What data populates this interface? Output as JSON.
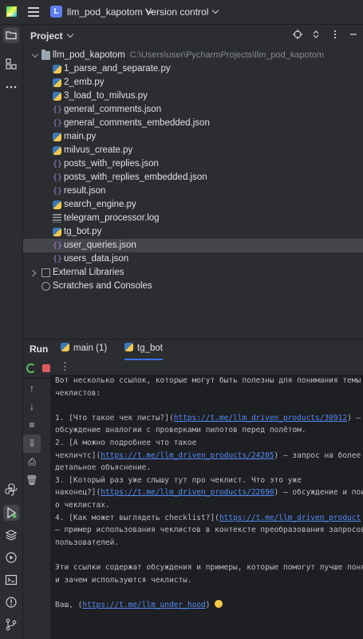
{
  "topbar": {
    "project_badge": "L",
    "project_name": "llm_pod_kapotom",
    "vcs_label": "Version control"
  },
  "project_panel": {
    "title": "Project",
    "root": {
      "name": "llm_pod_kapotom",
      "path": "C:\\Users\\user\\PycharmProjects\\llm_pod_kapotom"
    },
    "files": [
      {
        "name": "1_parse_and_separate.py",
        "type": "py"
      },
      {
        "name": "2_emb.py",
        "type": "py"
      },
      {
        "name": "3_load_to_milvus.py",
        "type": "py"
      },
      {
        "name": "general_comments.json",
        "type": "json"
      },
      {
        "name": "general_comments_embedded.json",
        "type": "json"
      },
      {
        "name": "main.py",
        "type": "py"
      },
      {
        "name": "milvus_create.py",
        "type": "py"
      },
      {
        "name": "posts_with_replies.json",
        "type": "json"
      },
      {
        "name": "posts_with_replies_embedded.json",
        "type": "json"
      },
      {
        "name": "result.json",
        "type": "json"
      },
      {
        "name": "search_engine.py",
        "type": "py"
      },
      {
        "name": "telegram_processor.log",
        "type": "log"
      },
      {
        "name": "tg_bot.py",
        "type": "py"
      },
      {
        "name": "user_queries.json",
        "type": "json",
        "selected": true
      },
      {
        "name": "users_data.json",
        "type": "json"
      }
    ],
    "external_libraries": "External Libraries",
    "scratches": "Scratches and Consoles"
  },
  "run_panel": {
    "title": "Run",
    "tabs": [
      {
        "label": "main (1)"
      },
      {
        "label": "tg_bot"
      }
    ],
    "console_lines": [
      [
        {
          "t": "Вот несколько ссылок, которые могут быть полезны для понимания темы"
        }
      ],
      [
        {
          "t": "чеклистов:"
        }
      ],
      [
        {
          "t": ""
        }
      ],
      [
        {
          "t": "1. [Что такое чек листы?]("
        },
        {
          "t": "https://t.me/llm_driven_products/30912",
          "link": true
        },
        {
          "t": ") —"
        }
      ],
      [
        {
          "t": "обсуждение аналогии с проверками пилотов перед полётом."
        }
      ],
      [
        {
          "t": "2. [А можно подробнее что такое"
        }
      ],
      [
        {
          "t": "чекличтс]("
        },
        {
          "t": "https://t.me/llm_driven_products/24205",
          "link": true
        },
        {
          "t": ") — запрос на более"
        }
      ],
      [
        {
          "t": "детальное объяснение."
        }
      ],
      [
        {
          "t": "3. [Который раз уже слышу тут про чеклист. Что это уже"
        }
      ],
      [
        {
          "t": "наконец?]("
        },
        {
          "t": "https://t.me/llm_driven_products/22690",
          "link": true
        },
        {
          "t": ") — обсуждение и пои"
        }
      ],
      [
        {
          "t": "о чеклистах."
        }
      ],
      [
        {
          "t": "4. [Как может выглядеть checklist?]("
        },
        {
          "t": "https://t.me/llm_driven_product",
          "link": true
        }
      ],
      [
        {
          "t": "— пример использования чеклистов в контексте преобразования запросов"
        }
      ],
      [
        {
          "t": "пользователей."
        }
      ],
      [
        {
          "t": ""
        }
      ],
      [
        {
          "t": "Эти ссылки содержат обсуждения и примеры, которые помогут лучше поня"
        }
      ],
      [
        {
          "t": "и зачем используются чеклисты."
        }
      ],
      [
        {
          "t": ""
        }
      ],
      [
        {
          "t": "Ваш, ("
        },
        {
          "t": "https://t.me/llm_under_hood",
          "link": true
        },
        {
          "t": ") "
        },
        {
          "emoji": "smiling-face"
        }
      ]
    ]
  },
  "colors": {
    "background": "#2b2d30",
    "console_bg": "#1e1f22",
    "link": "#548af7",
    "accent": "#3574f0",
    "selected_row": "#43454a"
  }
}
